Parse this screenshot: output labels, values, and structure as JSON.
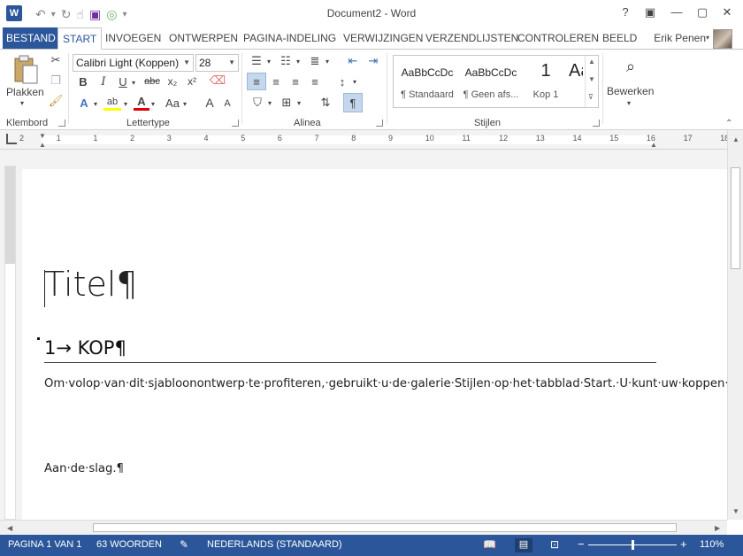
{
  "window": {
    "title": "Document2 - Word",
    "help": "?",
    "controls": {
      "ribbon_options": "▣",
      "minimize": "—",
      "maximize": "▢",
      "close": "✕"
    }
  },
  "qat": {
    "logo": "W",
    "undo": "↶",
    "redo": "↻",
    "touch": "☝",
    "save": "💾",
    "customize": "▾"
  },
  "tabs": [
    "BESTAND",
    "START",
    "INVOEGEN",
    "ONTWERPEN",
    "PAGINA-INDELING",
    "VERWIJZINGEN",
    "VERZENDLIJSTEN",
    "CONTROLEREN",
    "BEELD"
  ],
  "user": {
    "name": "Erik Penen"
  },
  "ribbon": {
    "clipboard": {
      "label": "Klembord",
      "paste": "Plakken"
    },
    "font": {
      "label": "Lettertype",
      "family": "Calibri Light (Koppen)",
      "size": "28",
      "bold": "B",
      "italic": "I",
      "underline": "U",
      "strike": "abc",
      "subscript": "x₂",
      "superscript": "x²",
      "grow": "A",
      "shrink": "A",
      "case": "Aa"
    },
    "paragraph": {
      "label": "Alinea",
      "pilcrow": "¶"
    },
    "styles": {
      "label": "Stijlen",
      "items": [
        {
          "sample": "AaBbCcDc",
          "name": "¶ Standaard"
        },
        {
          "sample": "AaBbCcDc",
          "name": "¶ Geen afs..."
        },
        {
          "sample": "1",
          "name": "Kop 1"
        },
        {
          "sample": "AaE",
          "name": ""
        }
      ]
    },
    "editing": {
      "label": "Bewerken"
    }
  },
  "ruler": {
    "numbers": [
      "2",
      "1",
      "1",
      "2",
      "3",
      "4",
      "5",
      "6",
      "7",
      "8",
      "9",
      "10",
      "11",
      "12",
      "13",
      "14",
      "15",
      "16",
      "17",
      "18"
    ]
  },
  "document": {
    "title": "Titel¶",
    "heading": "1→ KOP¶",
    "body": "Om·volop·van·dit·sjabloonontwerp·te·profiteren,·gebruikt·u·de·galerie·Stijlen·op·het·tabblad·Start.·U·kunt·uw·koppen·bewerken·door·kopstijlen·te·gebruiken,·of·belangrijke·tekst·markeren·door·middel·van·andere·stijlen,·zoals·Emphasis·en·Intense·Quote.·Deze·stijlen·bevatten·opmaak·zodat·het·er·prachtig·uitziet·en·het·u·helpt·uw·ideeën·over·te·brengen¶",
    "body2": "Aan·de·slag.¶"
  },
  "status": {
    "page": "PAGINA 1 VAN 1",
    "words": "63 WOORDEN",
    "language": "NEDERLANDS (STANDAARD)",
    "zoom_minus": "−",
    "zoom_plus": "+",
    "zoom": "110%",
    "zoom_level_percent": 110
  },
  "colors": {
    "accent": "#2b579a"
  }
}
